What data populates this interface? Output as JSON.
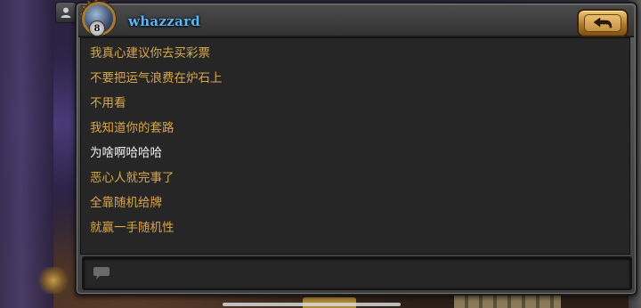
{
  "player": {
    "name": "whazzard",
    "level": "8"
  },
  "messages": [
    {
      "text": "我真心建议你去买彩票",
      "sender": "them"
    },
    {
      "text": "不要把运气浪费在炉石上",
      "sender": "them"
    },
    {
      "text": "不用看",
      "sender": "them"
    },
    {
      "text": "我知道你的套路",
      "sender": "them"
    },
    {
      "text": "为啥啊哈哈哈",
      "sender": "me"
    },
    {
      "text": "恶心人就完事了",
      "sender": "them"
    },
    {
      "text": "全靠随机给牌",
      "sender": "them"
    },
    {
      "text": "就赢一手随机性",
      "sender": "them"
    }
  ],
  "input": {
    "value": "",
    "placeholder": ""
  },
  "icons": {
    "friends": "friends-icon",
    "back": "back-arrow-icon",
    "chat": "chat-bubble-icon"
  },
  "colors": {
    "name": "#56b8ff",
    "incoming": "#d8a64a",
    "outgoing": "#f2f2f2",
    "panel": "#262626",
    "back_button": "#d6a24a"
  }
}
